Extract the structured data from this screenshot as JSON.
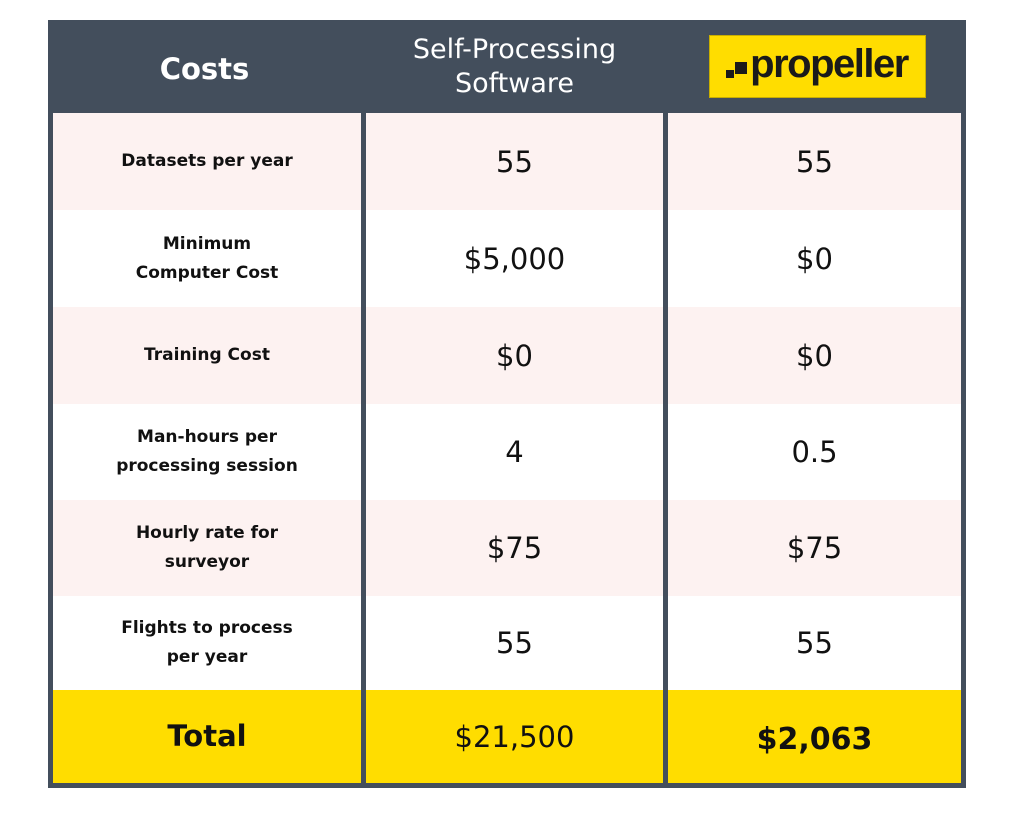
{
  "chart_data": {
    "type": "table",
    "title": "",
    "columns": [
      "Costs",
      "Self-Processing Software",
      "propeller"
    ],
    "rows": [
      {
        "label": "Datasets per year",
        "self_processing": "55",
        "propeller": "55"
      },
      {
        "label": "Minimum Computer Cost",
        "self_processing": "$5,000",
        "propeller": "$0"
      },
      {
        "label": "Training Cost",
        "self_processing": "$0",
        "propeller": "$0"
      },
      {
        "label": "Man-hours per processing session",
        "self_processing": "4",
        "propeller": "0.5"
      },
      {
        "label": "Hourly rate for surveyor",
        "self_processing": "$75",
        "propeller": "$75"
      },
      {
        "label": "Flights to process per year",
        "self_processing": "55",
        "propeller": "55"
      }
    ],
    "total": {
      "label": "Total",
      "self_processing": "$21,500",
      "propeller": "$2,063"
    }
  },
  "header": {
    "col0": "Costs",
    "col1_line1": "Self-Processing",
    "col1_line2": "Software",
    "col2_logo_text": "propeller",
    "col2_logo_icon": "propeller-logo-mark"
  },
  "rows": [
    {
      "label_line1": "Datasets per year",
      "label_line2": "",
      "self": "55",
      "propeller": "55"
    },
    {
      "label_line1": "Minimum",
      "label_line2": "Computer Cost",
      "self": "$5,000",
      "propeller": "$0"
    },
    {
      "label_line1": "Training Cost",
      "label_line2": "",
      "self": "$0",
      "propeller": "$0"
    },
    {
      "label_line1": "Man-hours per",
      "label_line2": "processing session",
      "self": "4",
      "propeller": "0.5"
    },
    {
      "label_line1": "Hourly rate for",
      "label_line2": "surveyor",
      "self": "$75",
      "propeller": "$75"
    },
    {
      "label_line1": "Flights to process",
      "label_line2": "per year",
      "self": "55",
      "propeller": "55"
    }
  ],
  "total": {
    "label": "Total",
    "self": "$21,500",
    "propeller": "$2,063"
  },
  "colors": {
    "header_bg": "#434e5c",
    "border": "#434e5c",
    "row_pink": "#fdf2f1",
    "row_white": "#ffffff",
    "highlight_yellow": "#ffdd00",
    "text_dark": "#111111"
  }
}
